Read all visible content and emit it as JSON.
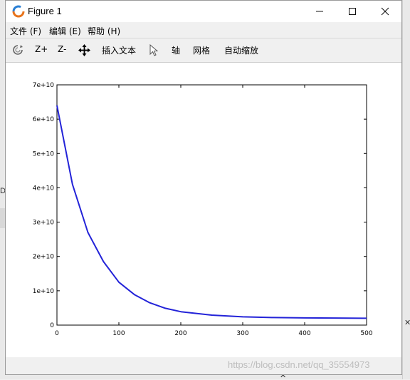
{
  "window": {
    "title": "Figure 1",
    "icon": "octave-figure-icon",
    "controls": [
      "minimize-icon",
      "maximize-icon",
      "close-icon"
    ]
  },
  "menu": [
    {
      "label": "文件 (F)"
    },
    {
      "label": "编辑 (E)"
    },
    {
      "label": "帮助 (H)"
    }
  ],
  "toolbar": {
    "rotate_icon": "rotate-icon",
    "zoom_in": "Z+",
    "zoom_out": "Z-",
    "pan_icon": "pan-move-icon",
    "insert_text": "插入文本",
    "select_icon": "pointer-arrow-icon",
    "axis": "轴",
    "grid": "网格",
    "autoscale": "自动缩放"
  },
  "background": {
    "left_text": "De"
  },
  "watermark": "https://blog.csdn.net/qq_35554973",
  "chart_data": {
    "type": "line",
    "title": "",
    "xlabel": "",
    "ylabel": "",
    "xlim": [
      0,
      500
    ],
    "ylim": [
      0,
      70000000000
    ],
    "x_ticks": [
      "0",
      "100",
      "200",
      "300",
      "400",
      "500"
    ],
    "y_ticks": [
      "0",
      "1e+10",
      "2e+10",
      "3e+10",
      "4e+10",
      "5e+10",
      "6e+10",
      "7e+10"
    ],
    "grid": false,
    "line_color": "#2323d8",
    "series": [
      {
        "x": [
          0,
          25,
          50,
          75,
          100,
          125,
          150,
          175,
          200,
          250,
          300,
          350,
          400,
          450,
          500
        ],
        "values": [
          64000000000,
          41000000000,
          27000000000,
          18500000000,
          12500000000,
          8900000000,
          6500000000,
          4900000000,
          3900000000,
          2900000000,
          2400000000,
          2200000000,
          2100000000,
          2050000000,
          2000000000
        ]
      }
    ]
  }
}
